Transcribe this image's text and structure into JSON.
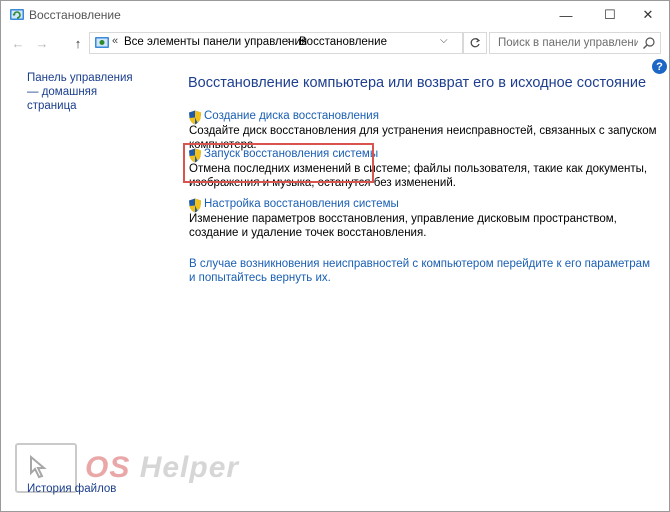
{
  "window": {
    "title": "Восстановление",
    "controls": {
      "minimize": "—",
      "maximize": "☐",
      "close": "✕"
    }
  },
  "address_bar": {
    "overflow": "«",
    "crumbs": [
      "Все элементы панели управления",
      "Восстановление"
    ],
    "separator": "›",
    "dropdown": "⌵",
    "search_placeholder": "Поиск в панели управления"
  },
  "nav": {
    "back": "←",
    "forward": "→",
    "up": "↑"
  },
  "left_pane": {
    "home_link": "Панель управления — домашняя страница",
    "bottom_link": "История файлов"
  },
  "help_label": "?",
  "main": {
    "title": "Восстановление компьютера или возврат его в исходное состояние",
    "items": [
      {
        "link": "Создание диска восстановления",
        "description": "Создайте диск восстановления для устранения неисправностей, связанных с запуском компьютера."
      },
      {
        "link": "Запуск восстановления системы",
        "description": "Отмена последних изменений в системе; файлы пользователя, такие как документы, изображения и музыка, останутся без изменений."
      },
      {
        "link": "Настройка восстановления системы",
        "description": "Изменение параметров восстановления, управление дисковым пространством, создание и удаление точек восстановления."
      }
    ],
    "footer_link": "В случае возникновения неисправностей с компьютером перейдите к его параметрам и попытайтесь вернуть их."
  },
  "watermark": {
    "prefix": "OS",
    "suffix": " Helper"
  },
  "colors": {
    "link": "#1a5fb4",
    "heading": "#1e3f8f",
    "highlight": "#d9534f",
    "help": "#1c66c6"
  },
  "icons": [
    "recovery-app-icon",
    "uac-shield-icon",
    "search-icon",
    "refresh-icon"
  ]
}
